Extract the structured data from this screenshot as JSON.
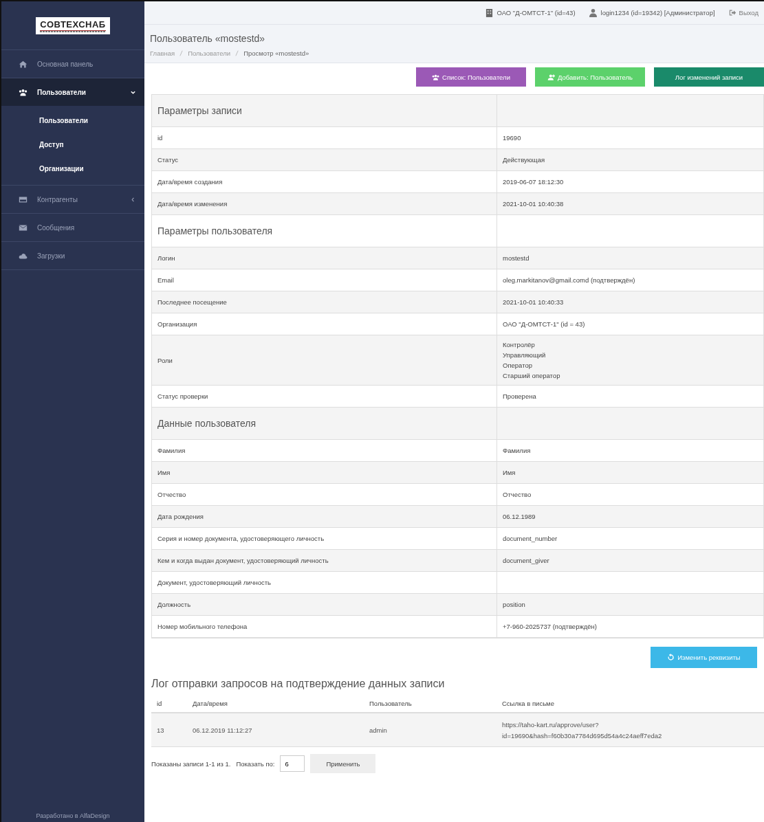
{
  "sidebar": {
    "logo": "СОВТЕХСНАБ",
    "items": [
      {
        "label": "Основная панель",
        "selected": false
      },
      {
        "label": "Пользователи",
        "selected": true,
        "expanded": true,
        "children": [
          {
            "label": "Пользователи"
          },
          {
            "label": "Доступ"
          },
          {
            "label": "Организации"
          }
        ]
      },
      {
        "label": "Контрагенты",
        "selected": false,
        "expanded": false
      },
      {
        "label": "Сообщения",
        "selected": false
      },
      {
        "label": "Загрузки",
        "selected": false
      }
    ],
    "footer": "Разработано в AlfaDesign"
  },
  "topbar": {
    "organization": "ОАО \"Д-ОМТСТ-1\" (id=43)",
    "user": "login1234 (id=19342) [Администратор]",
    "logout": "Выход"
  },
  "page": {
    "title": "Пользователь «mostestd»",
    "breadcrumbs": [
      {
        "label": "Главная",
        "current": false
      },
      {
        "label": "Пользователи",
        "current": false
      },
      {
        "label": "Просмотр «mostestd»",
        "current": true
      }
    ]
  },
  "actions": [
    {
      "label": "Список: Пользователи",
      "color": "#9b59b6"
    },
    {
      "label": "Добавить: Пользователь",
      "color": "#5cd16b"
    },
    {
      "label": "Лог изменений записи",
      "color": "#1a8a6a"
    }
  ],
  "table": {
    "rows": [
      {
        "kind": "section",
        "label": "Параметры записи"
      },
      {
        "kind": "field",
        "label": "id",
        "value": "19690"
      },
      {
        "kind": "field",
        "label": "Статус",
        "value": "Действующая"
      },
      {
        "kind": "field",
        "label": "Дата/время создания",
        "value": "2019-06-07 18:12:30"
      },
      {
        "kind": "field",
        "label": "Дата/время изменения",
        "value": "2021-10-01 10:40:38"
      },
      {
        "kind": "section",
        "label": "Параметры пользователя"
      },
      {
        "kind": "field",
        "label": "Логин",
        "value": "mostestd"
      },
      {
        "kind": "field",
        "label": "Email",
        "value": "oleg.markitanov@gmail.comd (подтверждён)"
      },
      {
        "kind": "field",
        "label": "Последнее посещение",
        "value": "2021-10-01 10:40:33"
      },
      {
        "kind": "field",
        "label": "Организация",
        "value": "ОАО \"Д-ОМТСТ-1\" (id = 43)"
      },
      {
        "kind": "list",
        "label": "Роли",
        "values": [
          "Контролёр",
          "Управляющий",
          "Оператор",
          "Старший оператор"
        ]
      },
      {
        "kind": "field",
        "label": "Статус проверки",
        "value": "Проверена"
      },
      {
        "kind": "section",
        "label": "Данные пользователя"
      },
      {
        "kind": "field",
        "label": "Фамилия",
        "value": "Фамилия"
      },
      {
        "kind": "field",
        "label": "Имя",
        "value": "Имя"
      },
      {
        "kind": "field",
        "label": "Отчество",
        "value": "Отчество"
      },
      {
        "kind": "field",
        "label": "Дата рождения",
        "value": "06.12.1989"
      },
      {
        "kind": "field",
        "label": "Серия и номер документа, удостоверяющего личность",
        "value": "document_number"
      },
      {
        "kind": "field",
        "label": "Кем и когда выдан документ, удостоверяющий личность",
        "value": "document_giver"
      },
      {
        "kind": "field",
        "label": "Документ, удостоверяющий личность"
      },
      {
        "kind": "field",
        "label": "Должность",
        "value": "position"
      },
      {
        "kind": "field",
        "label": "Номер мобильного телефона",
        "value": "+7-960-2025737 (подтверждён)"
      }
    ]
  },
  "edit_button": "Изменить реквизиты",
  "log": {
    "title": "Лог отправки запросов на подтверждение данных записи",
    "columns": [
      "id",
      "Дата/время",
      "Пользователь",
      "Ссылка в письме"
    ],
    "rows": [
      {
        "id": "13",
        "datetime": "06.12.2019 11:12:27",
        "user": "admin",
        "link": [
          "https://taho-kart.ru/approve/user?",
          "id=19690&hash=f60b30a7784d695d54a4c24aeff7eda2"
        ]
      }
    ]
  },
  "pager": {
    "summary": "Показаны записи 1-1 из 1.",
    "per_page_label": "Показать по:",
    "per_page": "6",
    "apply": "Применить"
  }
}
